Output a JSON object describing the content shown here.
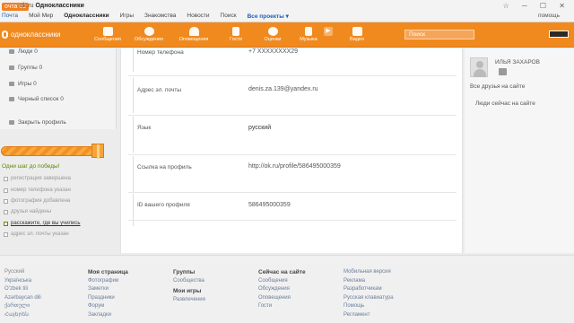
{
  "browser": {
    "tab_label": "очта 69",
    "url_domain": "ok.ru",
    "url_title": "Одноклассники",
    "bookmarks": [
      "Почта",
      "Мой Мир",
      "Одноклассники",
      "Игры",
      "Знакомства",
      "Новости",
      "Поиск",
      "Все проекты ▾"
    ],
    "right_link": "помощь"
  },
  "header": {
    "logo": "одноклассники",
    "nav": [
      {
        "label": "Сообщения",
        "icon": "envelope-icon"
      },
      {
        "label": "Обсуждения",
        "icon": "discussion-icon"
      },
      {
        "label": "Оповещения",
        "icon": "bell-icon"
      },
      {
        "label": "Гости",
        "icon": "footprints-icon"
      },
      {
        "label": "Оценки",
        "icon": "star-icon"
      },
      {
        "label": "Музыка",
        "icon": "music-note-icon"
      },
      {
        "label": "",
        "icon": "play-icon"
      },
      {
        "label": "Видео",
        "icon": "video-camera-icon"
      }
    ],
    "search_placeholder": "Поиск"
  },
  "left": {
    "menu": [
      {
        "label": "Люди 0",
        "icon": "people-icon"
      },
      {
        "label": "Группы 0",
        "icon": "groups-icon"
      },
      {
        "label": "Игры 0",
        "icon": "games-icon"
      },
      {
        "label": "Черный список 0",
        "icon": "blacklist-icon"
      }
    ],
    "close_profile": "Закрыть профиль",
    "progress_title": "Одни шаг до победы!",
    "steps": [
      {
        "label": "регистрация завершена",
        "done": true
      },
      {
        "label": "номер телефона указан",
        "done": true
      },
      {
        "label": "фотография добавлена",
        "done": true
      },
      {
        "label": "друзья найдены",
        "done": true
      },
      {
        "label": "расскажите, где вы учились",
        "done": false
      },
      {
        "label": "адрес эл. почты указан",
        "done": true
      }
    ]
  },
  "profile": {
    "fields": [
      {
        "label": "Номер телефона",
        "value": "+7 XXXXXXXX29"
      },
      {
        "label": "Адрес эл. почты",
        "value": "denis.za.139@yandex.ru"
      },
      {
        "label": "Язык",
        "value": "русский"
      },
      {
        "label": "Ссылка на профиль",
        "value": "http://ok.ru/profile/586495000359"
      },
      {
        "label": "ID вашего профиля",
        "value": "586495000359"
      }
    ]
  },
  "right": {
    "name": "ИЛЬЯ ЗАХАРОВ",
    "all_friends": "Все друзья на сайте",
    "people_online": "Люди сейчас на сайте"
  },
  "footer": {
    "languages": [
      "Русский",
      "Українська",
      "Oʻzbek tili",
      "Azərbaycan dili",
      "ქართული",
      "Հայերեն"
    ],
    "col_my_page": {
      "title": "Моя страница",
      "items": [
        "Фотографии",
        "Заметки",
        "Праздники",
        "Форум",
        "Закладки"
      ]
    },
    "col_groups": {
      "title": "Группы",
      "items": [
        "Сообщества"
      ],
      "title2": "Мои игры",
      "items2": [
        "Развлечения"
      ]
    },
    "col_now": {
      "title": "Сейчас на сайте",
      "items": [
        "Сообщения",
        "Обсуждения",
        "Оповещения",
        "Гости"
      ]
    },
    "col_more": {
      "items": [
        "Мобильная версия",
        "Реклама",
        "Разработчикам",
        "Русская клавиатура",
        "Помощь",
        "Регламент"
      ]
    }
  }
}
